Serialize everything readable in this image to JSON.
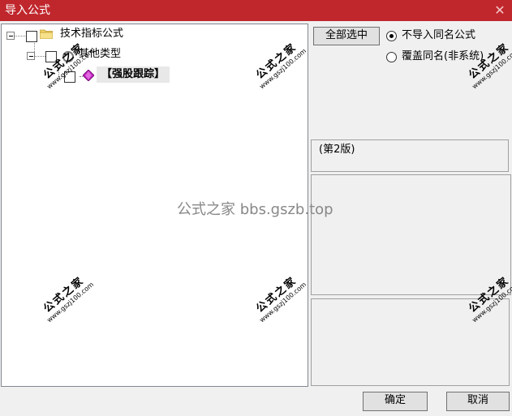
{
  "window": {
    "title": "导入公式",
    "close_glyph": "✕"
  },
  "tree": {
    "root_label": "技术指标公式",
    "group_label": "其他类型",
    "item_label": "【强股跟踪】"
  },
  "options": {
    "select_all_label": "全部选中",
    "radio_no_import": "不导入同名公式",
    "radio_overwrite": "覆盖同名(非系统)"
  },
  "info": {
    "version": "(第2版)"
  },
  "buttons": {
    "ok": "确定",
    "cancel": "取消"
  },
  "watermarks": {
    "center": "公式之家 bbs.gszb.top",
    "stamp_cn": "公式之家",
    "stamp_url": "www.gszj100.com"
  },
  "colors": {
    "titlebar": "#c0272d"
  }
}
